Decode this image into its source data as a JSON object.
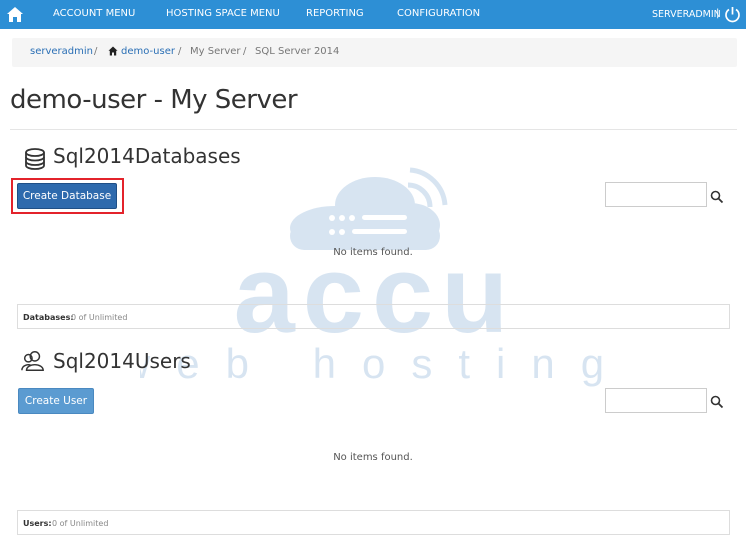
{
  "topbar": {
    "menu": [
      "ACCOUNT MENU",
      "HOSTING SPACE MENU",
      "REPORTING",
      "CONFIGURATION"
    ],
    "user": "SERVERADMIN",
    "separator": "|"
  },
  "breadcrumb": {
    "items": [
      "serveradmin",
      "demo-user",
      "My Server",
      "SQL Server 2014"
    ],
    "divider": "/"
  },
  "page": {
    "title": "demo-user - My Server"
  },
  "databases": {
    "title": "Sql2014Databases",
    "create_label": "Create Database",
    "empty_text": "No items found.",
    "quota_label": "Databases:",
    "quota_value": "0 of Unlimited"
  },
  "users": {
    "title": "Sql2014Users",
    "create_label": "Create User",
    "empty_text": "No items found.",
    "quota_label": "Users:",
    "quota_value": "0 of Unlimited"
  },
  "watermark": {
    "line1": "accu",
    "line2": "web hosting"
  },
  "colors": {
    "topbar": "#2d8fd5",
    "primary_button": "#2e6aad",
    "highlight": "#e3232b"
  }
}
